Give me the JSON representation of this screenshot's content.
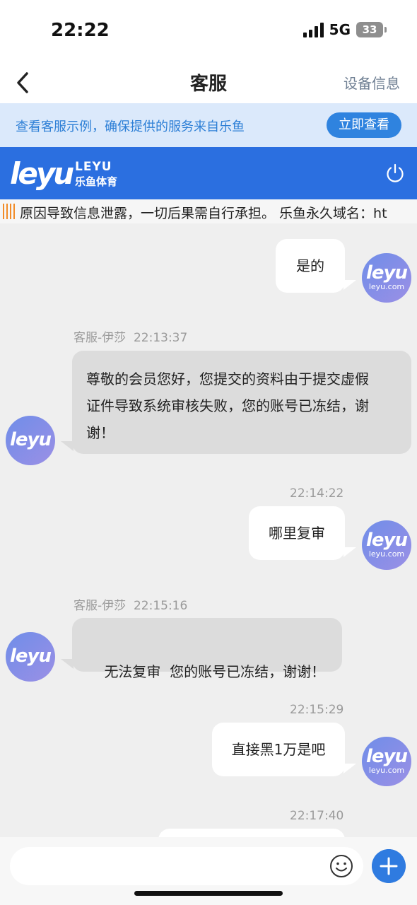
{
  "status": {
    "time": "22:22",
    "network": "5G",
    "battery": "33"
  },
  "nav": {
    "title": "客服",
    "right_action": "设备信息"
  },
  "notice": {
    "text": "查看客服示例，确保提供的服务来自乐鱼",
    "button": "立即查看"
  },
  "brand": {
    "logo_main": "leyu",
    "logo_en": "LEYU",
    "logo_cn": "乐鱼体育"
  },
  "marquee": {
    "text": "原因导致信息泄露，一切后果需自行承担。 乐鱼永久域名：ht"
  },
  "avatar": {
    "user_main": "leyu",
    "user_sub": "leyu.com",
    "agent_main": "leyu"
  },
  "messages": [
    {
      "from": "me",
      "text": "是的"
    },
    {
      "from": "agent",
      "sender": "客服-伊莎",
      "time": "22:13:37",
      "lines": [
        "尊敬的会员您好，您提交的资料由于提交虚假",
        "证件导致系统审核失败，您的账号已冻结，谢",
        "谢！"
      ]
    },
    {
      "from": "me",
      "time": "22:14:22",
      "text": "哪里复审"
    },
    {
      "from": "agent",
      "sender": "客服-伊莎",
      "time": "22:15:16",
      "text": "无法复审  您的账号已冻结，谢谢！"
    },
    {
      "from": "me",
      "time": "22:15:29",
      "text": "直接黑1万是吧"
    },
    {
      "from": "me",
      "time": "22:17:40",
      "text": ""
    }
  ],
  "input": {
    "placeholder": ""
  },
  "colors": {
    "brand_blue": "#2b6fe0",
    "notice_bg": "#dbe9fb",
    "accent": "#2f83df"
  }
}
